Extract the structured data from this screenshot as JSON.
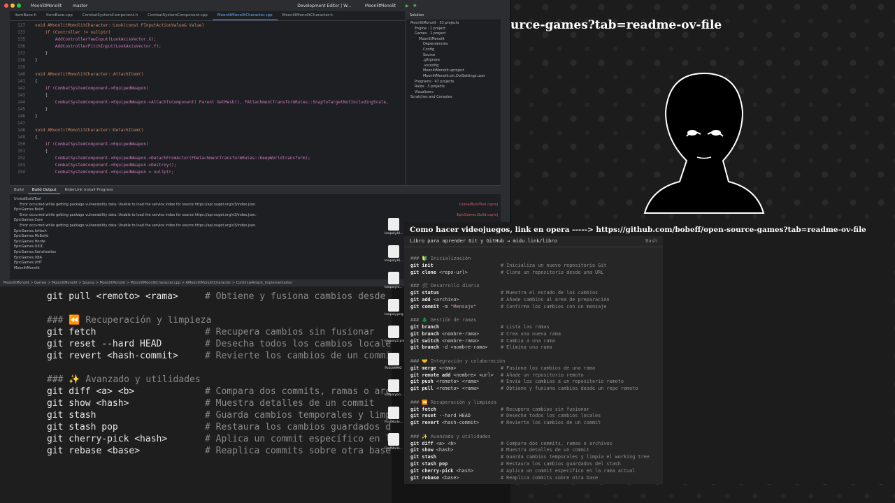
{
  "right_title": "urce-games?tab=readme-ov-file",
  "ide": {
    "title": {
      "project": "MoonlitMonolit",
      "branch": "master",
      "config": "Development Editor | W...",
      "target": "MoonlitMonolit"
    },
    "tabs": [
      "ItemBase.h",
      "ItemBase.cpp",
      "CombatSystemComponent.h",
      "CombatSystemComponent.cpp",
      "MoonlitMonolitCharacter.cpp",
      "MoonlitMonolitCharacter.h"
    ],
    "active_tab": "MoonlitMonolitCharacter.cpp",
    "code": [
      {
        "n": "127",
        "t": "void AMoonlitMonolitCharacter::Look(const FInputActionValue& Value)"
      },
      {
        "n": "133",
        "t": "    if (Controller != nullptr)"
      },
      {
        "n": "135",
        "t": "        AddControllerYawInput(LookAxisVector.X);"
      },
      {
        "n": "136",
        "t": "        AddControllerPitchInput(LookAxisVector.Y);"
      },
      {
        "n": "137",
        "t": "    }"
      },
      {
        "n": "138",
        "t": "}"
      },
      {
        "n": "139",
        "t": ""
      },
      {
        "n": "140",
        "t": "void AMoonlitMonolitCharacter::AttachItem()"
      },
      {
        "n": "141",
        "t": "{"
      },
      {
        "n": "142",
        "t": "    if (CombatSystemComponent->EquipedWeapon)"
      },
      {
        "n": "143",
        "t": "    {"
      },
      {
        "n": "144",
        "t": "        CombatSystemComponent->EquipedWeapon->AttachToComponent( Parent GetMesh(), FAttachmentTransformRules::SnapToTargetNotIncludingScale,"
      },
      {
        "n": "145",
        "t": "    }"
      },
      {
        "n": "146",
        "t": "}"
      },
      {
        "n": "147",
        "t": ""
      },
      {
        "n": "148",
        "t": "void AMoonlitMonolitCharacter::DetachItem()"
      },
      {
        "n": "149",
        "t": "{"
      },
      {
        "n": "150",
        "t": "    if (CombatSystemComponent->EquipedWeapon)"
      },
      {
        "n": "151",
        "t": "    {"
      },
      {
        "n": "152",
        "t": "        CombatSystemComponent->EquipedWeapon->DetachFromActor(FDetachmentTransformRules::KeepWorldTransform);"
      },
      {
        "n": "153",
        "t": "        CombatSystemComponent->EquipedWeapon->Destroy();"
      },
      {
        "n": "154",
        "t": "        CombatSystemComponent->EquipedWeapon = nullptr;"
      }
    ],
    "solution_header": "Solution",
    "solution": [
      "MoonlitMonolit · 53 projects",
      "Engine · 1 project",
      "Games · 1 project",
      "MoonlitMonolit",
      "Dependencies",
      "Config",
      "Source",
      ".gitignore",
      ".vsconfig",
      "MoonlitMonolit.uproject",
      "MoonlitMonolit.sln.DotSettings.user",
      "Programs · 47 projects",
      "Rules · 3 projects",
      "Visualizers",
      "Scratches and Consoles"
    ],
    "build_tabs": [
      "Build",
      "Build Output",
      "RiderLink Install Progress"
    ],
    "build_lines": [
      "UnrealBuildTool",
      "Error occurred while getting package vulnerability data: Unable to load the service index for source https://api.nuget.org/v3/index.json.",
      "EpicGames.Build",
      "Error occurred while getting package vulnerability data: Unable to load the service index for source https://api.nuget.org/v3/index.json.",
      "EpicGames.Core",
      "Error occurred while getting package vulnerability data: Unable to load the service index for source https://api.nuget.org/v3/index.json.",
      "EpicGames.IoHash",
      "EpicGames.MsBuild",
      "EpicGames.Horde",
      "EpicGames.OIDC",
      "EpicGames.Serialization",
      "EpicGames.UBA",
      "EpicGames.UHT",
      "MoonlitMonolit"
    ],
    "build_right": [
      "UnrealBuildTool.csproj",
      "EpicGames.Build.csproj"
    ],
    "statusbar": "MoonlitMonolit  >  Games  >  MoonlitMonolit  >  Source  >  MoonlitMonolit  >  MoonlitMonolitCharacter.cpp  >  AMoonlitMonolitCharacter  >  ContinueAttack_Implementation"
  },
  "bigterm": [
    {
      "cmd": "git pull <remoto> <rama>",
      "com": "# Obtiene y fusiona cambios desde"
    },
    {
      "cmd": "",
      "com": ""
    },
    {
      "cmd": "### ⏪ Recuperación y limpieza",
      "com": ""
    },
    {
      "cmd": "git fetch",
      "com": "# Recupera cambios sin fusionar"
    },
    {
      "cmd": "git reset --hard HEAD",
      "com": "# Desecha todos los cambios locale"
    },
    {
      "cmd": "git revert <hash-commit>",
      "com": "# Revierte los cambios de un commi"
    },
    {
      "cmd": "",
      "com": ""
    },
    {
      "cmd": "### ✨ Avanzado y utilidades",
      "com": ""
    },
    {
      "cmd": "git diff <a> <b>",
      "com": "# Compara dos commits, ramas o arc"
    },
    {
      "cmd": "git show <hash>",
      "com": "# Muestra detalles de un commit"
    },
    {
      "cmd": "git stash",
      "com": "# Guarda cambios temporales y limp"
    },
    {
      "cmd": "git stash pop",
      "com": "# Restaura los cambios guardados d"
    },
    {
      "cmd": "git cherry-pick <hash>",
      "com": "# Aplica un commit específico en l"
    },
    {
      "cmd": "git rebase <base>",
      "com": "# Reaplica commits sobre otra base"
    }
  ],
  "desktop_icons": [
    "lowpoly.bl...",
    "lowpoly.bl...",
    "lowpolyid...",
    "lowpoly.png",
    "lowpoly2.png",
    "PolishMMO",
    "lowpolybo...",
    "FirstMode...",
    "FirstMode..."
  ],
  "terminal": {
    "title": "Como hacer videojuegos, link en opera -----> https://github.com/bobeff/open-source-games?tab=readme-ov-file",
    "header": "Libro para aprender Git y GitHub → midu.link/libro",
    "lang": "Bash",
    "lines": [
      {
        "h": "### 🔰 Inicialización"
      },
      {
        "c": "git init",
        "a": "",
        "m": "# Inicializa un nuevo repositorio Git"
      },
      {
        "c": "git clone",
        "a": " <repo-url>",
        "m": "# Clona un repositorio desde una URL"
      },
      {
        "h": ""
      },
      {
        "h": "### 🛠 Desarrollo diario"
      },
      {
        "c": "git status",
        "a": "",
        "m": "# Muestra el estado de los cambios"
      },
      {
        "c": "git add",
        "a": " <archivo>",
        "m": "# Añade cambios al área de preparación"
      },
      {
        "c": "git commit",
        "a": " -m ",
        "s": "\"Mensaje\"",
        "m": "# Confirma los cambios con un mensaje"
      },
      {
        "h": ""
      },
      {
        "h": "### 🌲 Gestión de ramas"
      },
      {
        "c": "git branch",
        "a": "",
        "m": "# Lista las ramas"
      },
      {
        "c": "git branch",
        "a": " <nombre-rama>",
        "m": "# Crea una nueva rama"
      },
      {
        "c": "git switch",
        "a": " <nombre-rama>",
        "m": "# Cambia a una rama"
      },
      {
        "c": "git branch",
        "a": " -d <nombre-rama>",
        "m": "# Elimina una rama"
      },
      {
        "h": ""
      },
      {
        "h": "### 🤝 Integración y colaboración"
      },
      {
        "c": "git merge",
        "a": " <rama>",
        "m": "# Fusiona los cambios de una rama"
      },
      {
        "c": "git remote add",
        "a": " <nombre> <url>",
        "m": "# Añade un repositorio remoto"
      },
      {
        "c": "git push",
        "a": " <remoto> <rama>",
        "m": "# Envía los cambios a un repositorio remoto"
      },
      {
        "c": "git pull",
        "a": " <remoto> <rama>",
        "m": "# Obtiene y fusiona cambios desde un repo remoto"
      },
      {
        "h": ""
      },
      {
        "h": "### ⏪ Recuperación y limpieza"
      },
      {
        "c": "git fetch",
        "a": "",
        "m": "# Recupera cambios sin fusionar"
      },
      {
        "c": "git reset",
        "a": " --hard HEAD",
        "m": "# Desecha todos los cambios locales"
      },
      {
        "c": "git revert",
        "a": " <hash-commit>",
        "m": "# Revierte los cambios de un commit"
      },
      {
        "h": ""
      },
      {
        "h": "### ✨ Avanzado y utilidades"
      },
      {
        "c": "git diff",
        "a": " <a> <b>",
        "m": "# Compara dos commits, ramas o archivos"
      },
      {
        "c": "git show",
        "a": " <hash>",
        "m": "# Muestra detalles de un commit"
      },
      {
        "c": "git stash",
        "a": "",
        "m": "# Guarda cambios temporales y limpia el working tree"
      },
      {
        "c": "git stash pop",
        "a": "",
        "m": "# Restaura los cambios guardados del stash"
      },
      {
        "c": "git cherry-pick",
        "a": " <hash>",
        "m": "# Aplica un commit específico en la rama actual"
      },
      {
        "c": "git rebase",
        "a": " <base>",
        "m": "# Reaplica commits sobre otra base"
      }
    ]
  }
}
